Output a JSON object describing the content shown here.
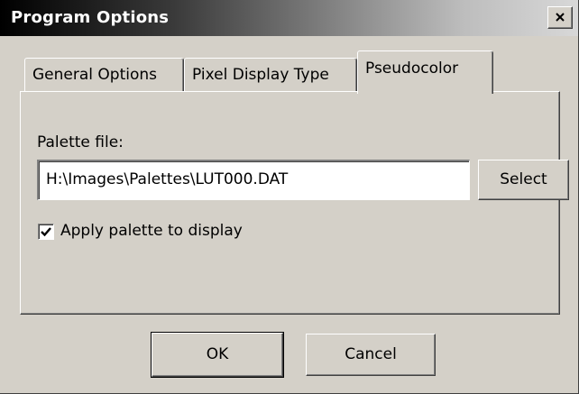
{
  "window": {
    "title": "Program Options",
    "close_icon": "close-icon"
  },
  "tabs": [
    {
      "label": "General Options",
      "selected": false
    },
    {
      "label": "Pixel Display Type",
      "selected": false
    },
    {
      "label": "Pseudocolor",
      "selected": true
    }
  ],
  "pseudocolor": {
    "palette_label": "Palette file:",
    "palette_value": "H:\\Images\\Palettes\\LUT000.DAT",
    "select_label": "Select",
    "apply_label": "Apply palette to display",
    "apply_checked": true
  },
  "footer": {
    "ok_label": "OK",
    "cancel_label": "Cancel"
  },
  "colors": {
    "face": "#d4d0c8",
    "titlebar_start": "#000000",
    "titlebar_end": "#d8d8d8"
  }
}
